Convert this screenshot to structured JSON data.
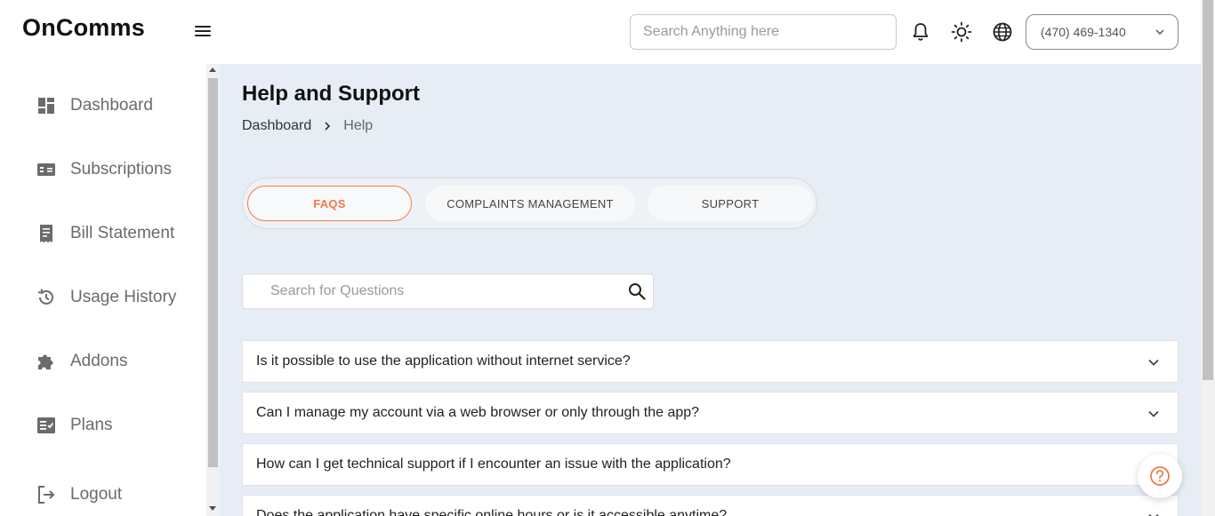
{
  "app": {
    "brand": "OnComms"
  },
  "header": {
    "search_placeholder": "Search Anything here",
    "phone_number": "(470) 469-1340",
    "icons": [
      "menu-icon",
      "bell-icon",
      "sun-icon",
      "globe-icon",
      "chevron-down-icon"
    ]
  },
  "sidebar": {
    "items": [
      {
        "label": "Dashboard",
        "icon": "dashboard-icon"
      },
      {
        "label": "Subscriptions",
        "icon": "subscriptions-icon"
      },
      {
        "label": "Bill Statement",
        "icon": "receipt-icon"
      },
      {
        "label": "Usage History",
        "icon": "history-icon"
      },
      {
        "label": "Addons",
        "icon": "puzzle-icon"
      },
      {
        "label": "Plans",
        "icon": "plans-icon"
      },
      {
        "label": "Logout",
        "icon": "logout-icon"
      }
    ]
  },
  "main": {
    "title": "Help and Support",
    "breadcrumb": {
      "home": "Dashboard",
      "current": "Help"
    },
    "tabs": [
      {
        "label": "FAQS",
        "active": true
      },
      {
        "label": "COMPLAINTS MANAGEMENT",
        "active": false
      },
      {
        "label": "SUPPORT",
        "active": false
      }
    ],
    "faq_search_placeholder": "Search for Questions",
    "faqs": [
      "Is it possible to use the application without internet service?",
      "Can I manage my account via a web browser or only through the app?",
      "How can I get technical support if I encounter an issue with the application?",
      "Does the application have specific online hours or is it accessible anytime?"
    ]
  },
  "colors": {
    "accent": "#f07b4a",
    "main_background": "#e7edf4",
    "sidebar_text": "#6b6b6b"
  }
}
